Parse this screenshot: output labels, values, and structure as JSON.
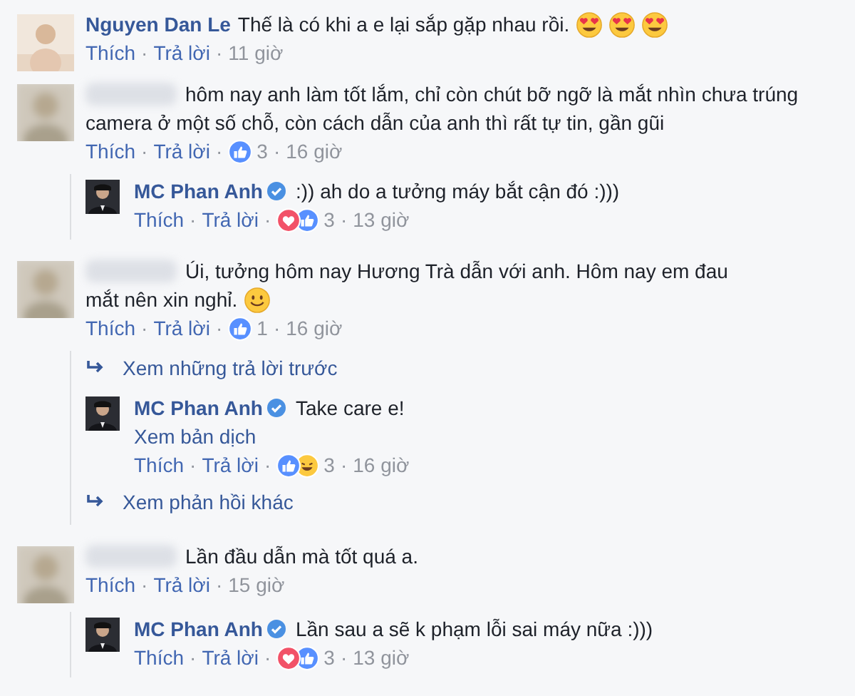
{
  "separator": "·",
  "items": [
    {
      "kind": "comment",
      "author": "Nguyen Dan Le",
      "author_hidden": false,
      "lines": [
        "Thế là có khi a e lại sắp gặp nhau rồi."
      ],
      "emojis": [
        {
          "kind": "heart-eyes"
        },
        {
          "kind": "heart-eyes"
        },
        {
          "kind": "heart-eyes"
        }
      ],
      "actions": [
        "Thích",
        "Trả lời"
      ],
      "time": "11 giờ"
    },
    {
      "kind": "comment",
      "author_hidden": true,
      "lines": [
        "hôm nay anh làm tốt lắm, chỉ còn chút bỡ ngỡ là mắt nhìn chưa trúng",
        "camera ở một số chỗ, còn cách dẫn của anh thì rất tự tin, gần gũi"
      ],
      "actions": [
        "Thích",
        "Trả lời"
      ],
      "reactions": [
        {
          "kind": "like"
        }
      ],
      "count": "3",
      "time": "16 giờ"
    },
    {
      "kind": "reply",
      "author": "MC Phan Anh",
      "author_hidden": false,
      "verified": true,
      "lines": [
        ":)) ah do a tưởng máy bắt cận đó :)))"
      ],
      "actions": [
        "Thích",
        "Trả lời"
      ],
      "reactions": [
        {
          "kind": "love"
        },
        {
          "kind": "like"
        }
      ],
      "count": "3",
      "time": "13 giờ"
    },
    {
      "kind": "comment",
      "author_hidden": true,
      "lines": [
        "Úi, tưởng hôm nay Hương Trà dẫn với anh. Hôm nay em đau",
        "mắt nên xin nghỉ."
      ],
      "emojis": [
        {
          "kind": "smile"
        }
      ],
      "actions": [
        "Thích",
        "Trả lời"
      ],
      "reactions": [
        {
          "kind": "like"
        }
      ],
      "count": "1",
      "time": "16 giờ"
    },
    {
      "kind": "more",
      "label": "Xem những trả lời trước"
    },
    {
      "kind": "reply",
      "author": "MC Phan Anh",
      "author_hidden": false,
      "verified": true,
      "lines": [
        "Take care e!"
      ],
      "translate": "Xem bản dịch",
      "actions": [
        "Thích",
        "Trả lời"
      ],
      "reactions": [
        {
          "kind": "like"
        },
        {
          "kind": "haha"
        }
      ],
      "count": "3",
      "time": "16 giờ"
    },
    {
      "kind": "more",
      "label": "Xem phản hồi khác"
    },
    {
      "kind": "comment",
      "author_hidden": true,
      "lines": [
        "Lần đầu dẫn mà tốt quá a."
      ],
      "actions": [
        "Thích",
        "Trả lời"
      ],
      "time": "15 giờ"
    },
    {
      "kind": "reply",
      "author": "MC Phan Anh",
      "author_hidden": false,
      "verified": true,
      "lines": [
        "Lần sau a sẽ k phạm lỗi sai máy nữa :)))"
      ],
      "actions": [
        "Thích",
        "Trả lời"
      ],
      "reactions": [
        {
          "kind": "love"
        },
        {
          "kind": "like"
        }
      ],
      "count": "3",
      "time": "13 giờ"
    }
  ]
}
